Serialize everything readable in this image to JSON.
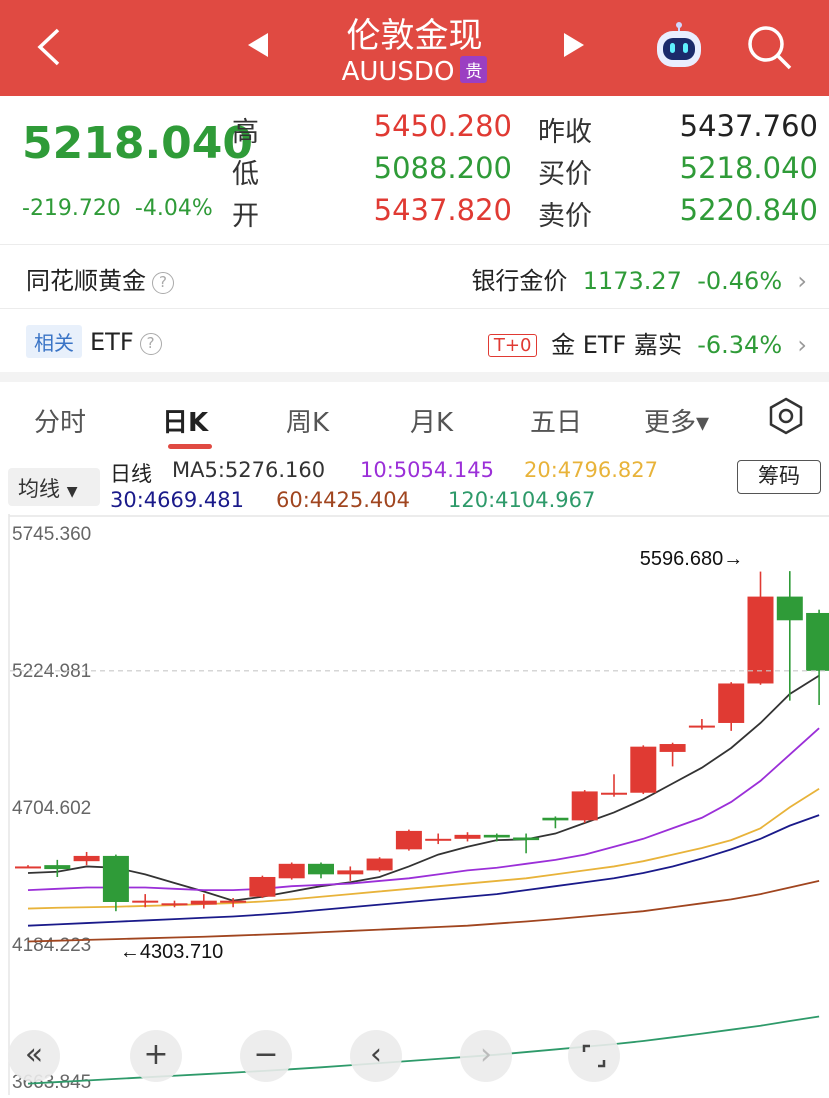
{
  "header": {
    "title": "伦敦金现",
    "symbol": "AUUSDO",
    "badge": "贵",
    "back_icon": "chevron-left-icon",
    "prev_icon": "triangle-left-icon",
    "next_icon": "triangle-right-icon",
    "robot_icon": "robot-icon",
    "search_icon": "search-icon",
    "bg_color": "#e04a42"
  },
  "quote": {
    "last": "5218.040",
    "change": "-219.720",
    "change_pct": "-4.04%",
    "high_label": "高",
    "high": "5450.280",
    "low_label": "低",
    "low": "5088.200",
    "open_label": "开",
    "open": "5437.820",
    "prev_close_label": "昨收",
    "prev_close": "5437.760",
    "bid_label": "买价",
    "bid": "5218.040",
    "ask_label": "卖价",
    "ask": "5220.840"
  },
  "related": {
    "gold_name": "同花顺黄金",
    "bank_gold_label": "银行金价",
    "bank_gold_value": "1173.27",
    "bank_gold_pct": "-0.46%",
    "rel_tag": "相关",
    "etf_label": "ETF",
    "t0_tag": "T+0",
    "etf_name": "金 ETF 嘉实",
    "etf_pct": "-6.34%"
  },
  "tabs": [
    "分时",
    "日K",
    "周K",
    "月K",
    "五日",
    "更多▾"
  ],
  "active_tab": "日K",
  "ma": {
    "selector": "均线",
    "period": "日线",
    "ma5": "MA5:5276.160",
    "ma10": "10:5054.145",
    "ma20": "20:4796.827",
    "ma30": "30:4669.481",
    "ma60": "60:4425.404",
    "ma120": "120:4104.967",
    "chips_btn": "筹码",
    "colors": {
      "ma5": "#333333",
      "ma10": "#9b2fd8",
      "ma20": "#e8b33a",
      "ma30": "#1a1a8a",
      "ma60": "#a0451f",
      "ma120": "#2e9a6a"
    }
  },
  "chart_data": {
    "type": "candlestick",
    "y_ticks": [
      "5745.360",
      "5224.981",
      "4704.602",
      "4184.223",
      "3663.845"
    ],
    "y_tick_values": [
      5745.36,
      5224.981,
      4704.602,
      4184.223,
      3663.845
    ],
    "ylim": [
      3663.845,
      5745.36
    ],
    "max_label": "5596.680→",
    "max_value": 5596.68,
    "min_label": "←4303.710",
    "min_value": 4303.71,
    "last_price": 5218.04,
    "candles": [
      {
        "o": 4475,
        "h": 4480,
        "l": 4470,
        "c": 4475
      },
      {
        "o": 4480,
        "h": 4500,
        "l": 4435,
        "c": 4465
      },
      {
        "o": 4495,
        "h": 4530,
        "l": 4480,
        "c": 4515
      },
      {
        "o": 4515,
        "h": 4520,
        "l": 4305,
        "c": 4340
      },
      {
        "o": 4340,
        "h": 4370,
        "l": 4320,
        "c": 4345
      },
      {
        "o": 4330,
        "h": 4345,
        "l": 4320,
        "c": 4335
      },
      {
        "o": 4330,
        "h": 4370,
        "l": 4315,
        "c": 4345
      },
      {
        "o": 4345,
        "h": 4355,
        "l": 4320,
        "c": 4345
      },
      {
        "o": 4360,
        "h": 4440,
        "l": 4355,
        "c": 4435
      },
      {
        "o": 4430,
        "h": 4490,
        "l": 4425,
        "c": 4485
      },
      {
        "o": 4485,
        "h": 4490,
        "l": 4430,
        "c": 4445
      },
      {
        "o": 4445,
        "h": 4475,
        "l": 4420,
        "c": 4460
      },
      {
        "o": 4460,
        "h": 4510,
        "l": 4455,
        "c": 4505
      },
      {
        "o": 4540,
        "h": 4615,
        "l": 4535,
        "c": 4610
      },
      {
        "o": 4580,
        "h": 4600,
        "l": 4560,
        "c": 4580
      },
      {
        "o": 4580,
        "h": 4605,
        "l": 4570,
        "c": 4595
      },
      {
        "o": 4595,
        "h": 4600,
        "l": 4570,
        "c": 4585
      },
      {
        "o": 4585,
        "h": 4600,
        "l": 4525,
        "c": 4575
      },
      {
        "o": 4660,
        "h": 4665,
        "l": 4620,
        "c": 4650
      },
      {
        "o": 4650,
        "h": 4765,
        "l": 4640,
        "c": 4760
      },
      {
        "o": 4755,
        "h": 4825,
        "l": 4740,
        "c": 4755
      },
      {
        "o": 4755,
        "h": 4935,
        "l": 4750,
        "c": 4930
      },
      {
        "o": 4910,
        "h": 4945,
        "l": 4855,
        "c": 4940
      },
      {
        "o": 5010,
        "h": 5035,
        "l": 4995,
        "c": 5010
      },
      {
        "o": 5020,
        "h": 5175,
        "l": 4990,
        "c": 5170
      },
      {
        "o": 5170,
        "h": 5595,
        "l": 5165,
        "c": 5500
      },
      {
        "o": 5500,
        "h": 5596.68,
        "l": 5105,
        "c": 5410
      },
      {
        "o": 5437.82,
        "h": 5450.28,
        "l": 5088.2,
        "c": 5218.04
      }
    ],
    "ma_series": [
      {
        "name": "MA5",
        "values": [
          4450,
          4455,
          4475,
          4470,
          4445,
          4412,
          4380,
          4345,
          4360,
          4380,
          4400,
          4415,
          4435,
          4475,
          4520,
          4550,
          4575,
          4578,
          4600,
          4640,
          4680,
          4730,
          4790,
          4850,
          4925,
          5020,
          5130,
          5200
        ]
      },
      {
        "name": "10",
        "values": [
          4385,
          4390,
          4395,
          4395,
          4395,
          4390,
          4385,
          4385,
          4390,
          4400,
          4405,
          4410,
          4420,
          4430,
          4445,
          4460,
          4470,
          4485,
          4500,
          4520,
          4550,
          4580,
          4620,
          4660,
          4720,
          4800,
          4900,
          5000
        ]
      },
      {
        "name": "20",
        "values": [
          4315,
          4318,
          4320,
          4322,
          4325,
          4328,
          4332,
          4336,
          4342,
          4350,
          4360,
          4370,
          4380,
          4390,
          4400,
          4410,
          4420,
          4430,
          4445,
          4460,
          4475,
          4495,
          4520,
          4545,
          4575,
          4620,
          4700,
          4770
        ]
      },
      {
        "name": "30",
        "values": [
          4250,
          4255,
          4260,
          4265,
          4270,
          4275,
          4280,
          4285,
          4292,
          4300,
          4310,
          4320,
          4330,
          4340,
          4350,
          4360,
          4370,
          4385,
          4400,
          4415,
          4430,
          4450,
          4475,
          4505,
          4540,
          4580,
          4630,
          4670
        ]
      },
      {
        "name": "60",
        "values": [
          4190,
          4193,
          4196,
          4199,
          4202,
          4205,
          4208,
          4212,
          4216,
          4220,
          4225,
          4230,
          4235,
          4240,
          4245,
          4250,
          4258,
          4266,
          4275,
          4285,
          4295,
          4305,
          4320,
          4335,
          4350,
          4370,
          4395,
          4420
        ]
      },
      {
        "name": "120",
        "values": [
          3650,
          3656,
          3662,
          3668,
          3674,
          3680,
          3686,
          3692,
          3698,
          3705,
          3712,
          3720,
          3728,
          3736,
          3744,
          3752,
          3760,
          3770,
          3780,
          3790,
          3800,
          3812,
          3826,
          3840,
          3855,
          3870,
          3888,
          3905
        ]
      }
    ]
  },
  "chart_nav": {
    "btn_rewind": "«",
    "btn_zoom_in": "+",
    "btn_zoom_out": "−",
    "btn_prev": "‹",
    "btn_next": "›",
    "btn_fullscreen": "fullscreen-icon"
  }
}
